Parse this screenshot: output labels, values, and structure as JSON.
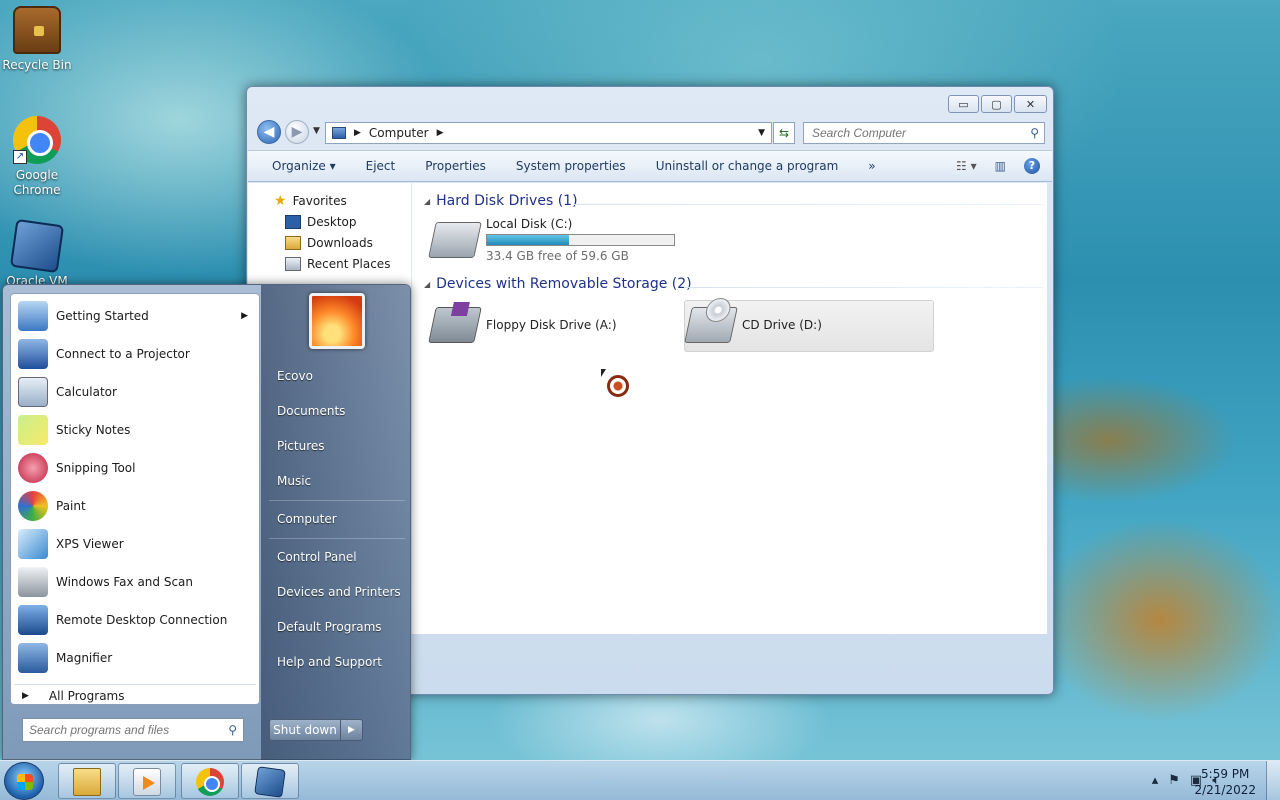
{
  "desktop": {
    "icons": [
      {
        "label": "Recycle Bin",
        "icon": "recycle-bin-icon"
      },
      {
        "label": "Google Chrome",
        "icon": "chrome-icon"
      },
      {
        "label": "Oracle VM",
        "icon": "virtualbox-icon"
      }
    ]
  },
  "explorer": {
    "window_controls": {
      "minimize": "▭",
      "maximize": "▢",
      "close": "✕"
    },
    "address": {
      "location": "Computer"
    },
    "search": {
      "placeholder": "Search Computer"
    },
    "toolbar": {
      "organize": "Organize ▾",
      "eject": "Eject",
      "properties": "Properties",
      "system_properties": "System properties",
      "uninstall": "Uninstall or change a program",
      "more": "»"
    },
    "tree": {
      "favorites": "Favorites",
      "desktop": "Desktop",
      "downloads": "Downloads",
      "recent_places": "Recent Places"
    },
    "groups": {
      "hdd_title": "Hard Disk Drives (1)",
      "removable_title": "Devices with Removable Storage (2)"
    },
    "drives": {
      "local_disk": {
        "name": "Local Disk (C:)",
        "free": "33.4 GB free of 59.6 GB",
        "used_fraction": 0.44
      },
      "floppy": {
        "name": "Floppy Disk Drive (A:)"
      },
      "cd": {
        "name": "CD Drive (D:)"
      }
    }
  },
  "start_menu": {
    "programs": [
      {
        "label": "Getting Started",
        "icon": "getting-started-icon",
        "has_submenu": true
      },
      {
        "label": "Connect to a Projector",
        "icon": "projector-icon"
      },
      {
        "label": "Calculator",
        "icon": "calculator-icon"
      },
      {
        "label": "Sticky Notes",
        "icon": "sticky-notes-icon"
      },
      {
        "label": "Snipping Tool",
        "icon": "scissors-icon"
      },
      {
        "label": "Paint",
        "icon": "paint-icon"
      },
      {
        "label": "XPS Viewer",
        "icon": "xps-viewer-icon"
      },
      {
        "label": "Windows Fax and Scan",
        "icon": "fax-icon"
      },
      {
        "label": "Remote Desktop Connection",
        "icon": "remote-desktop-icon"
      },
      {
        "label": "Magnifier",
        "icon": "magnifier-icon"
      }
    ],
    "all_programs": "All Programs",
    "search_placeholder": "Search programs and files",
    "right_links": {
      "user": "Ecovo",
      "documents": "Documents",
      "pictures": "Pictures",
      "music": "Music",
      "computer": "Computer",
      "control_panel": "Control Panel",
      "devices_printers": "Devices and Printers",
      "default_programs": "Default Programs",
      "help_support": "Help and Support"
    },
    "shutdown": "Shut down"
  },
  "taskbar": {
    "clock_time": "5:59 PM",
    "clock_date": "2/21/2022"
  }
}
